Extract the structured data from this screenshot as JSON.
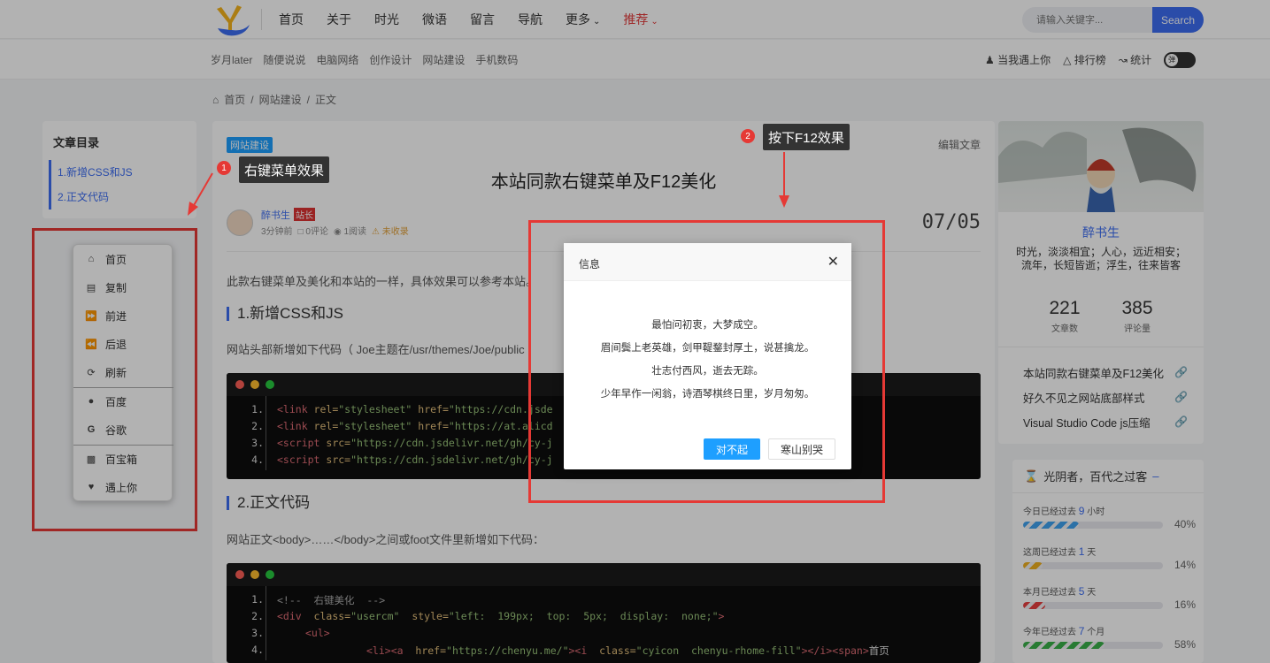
{
  "header": {
    "nav": [
      "首页",
      "关于",
      "时光",
      "微语",
      "留言",
      "导航"
    ],
    "more": "更多",
    "recommend": "推荐",
    "search_placeholder": "请输入关键字...",
    "search_button": "Search"
  },
  "subnav": {
    "links": [
      "岁月later",
      "随便说说",
      "电脑网络",
      "创作设计",
      "网站建设",
      "手机数码"
    ],
    "meet": "当我遇上你",
    "rank": "排行榜",
    "stats": "统计",
    "toggle_label": "弹"
  },
  "breadcrumb": {
    "home": "首页",
    "category": "网站建设",
    "current": "正文"
  },
  "toc": {
    "title": "文章目录",
    "items": [
      "1.新增CSS和JS",
      "2.正文代码"
    ]
  },
  "context_menu": {
    "items": [
      "首页",
      "复制",
      "前进",
      "后退",
      "刷新",
      "百度",
      "谷歌",
      "百宝箱",
      "遇上你"
    ]
  },
  "article": {
    "tag": "网站建设",
    "edit": "编辑文章",
    "title": "本站同款右键菜单及F12美化",
    "author": "醉书生",
    "author_badge": "站长",
    "time": "3分钟前",
    "comments": "0评论",
    "reads": "1阅读",
    "status": "未收录",
    "date": "07/05",
    "intro": "此款右键菜单及美化和本站的一样，具体效果可以参考本站。",
    "h1": "1.新增CSS和JS",
    "p1": "网站头部新增如下代码（ Joe主题在/usr/themes/Joe/public",
    "h2": "2.正文代码",
    "p2": "网站正文<body>……</body>之间或foot文件里新增如下代码："
  },
  "code1": {
    "lines": [
      {
        "n": "1.",
        "tag": "<link",
        "attr": " rel=",
        "str": "\"stylesheet\"",
        "attr2": " href=",
        "str2": "\"https://cdn.jsde"
      },
      {
        "n": "2.",
        "tag": "<link",
        "attr": " rel=",
        "str": "\"stylesheet\"",
        "attr2": " href=",
        "str2": "\"https://at.alicd"
      },
      {
        "n": "3.",
        "tag": "<script",
        "attr": " src=",
        "str": "\"https://cdn.jsdelivr.net/gh/cy-j",
        "attr2": "",
        "str2": ""
      },
      {
        "n": "4.",
        "tag": "<script",
        "attr": " src=",
        "str": "\"https://cdn.jsdelivr.net/gh/cy-j",
        "attr2": "",
        "str2": ""
      }
    ]
  },
  "code2": {
    "line1": "<!--  右键美化  -->",
    "line2_tag": "<div",
    "line2_attr": "  class=",
    "line2_str": "\"usercm\"",
    "line2_attr2": "  style=",
    "line2_str2": "\"left:  199px;  top:  5px;  display:  none;\"",
    "line2_end": ">",
    "line3": "<ul>",
    "line4_a": "<li><a",
    "line4_attr": "  href=",
    "line4_str": "\"https://chenyu.me/\"",
    "line4_b": "><i",
    "line4_attr2": "  class=",
    "line4_str2": "\"cyicon  chenyu-rhome-fill\"",
    "line4_c": "></i><span>",
    "line4_text": "首页",
    "nums": [
      "1.",
      "2.",
      "3.",
      "4."
    ]
  },
  "dialog": {
    "title": "信息",
    "lines": [
      "最怕问初衷，大梦成空。",
      "眉间鬓上老英雄，剑甲鞮鍪封厚土，说甚擒龙。",
      "壮志付西风，逝去无踪。",
      "少年早作一闲翁，诗酒琴棋终日里，岁月匆匆。"
    ],
    "ok": "对不起",
    "cancel": "寒山别哭"
  },
  "profile": {
    "name": "醉书生",
    "desc": "时光，淡淡相宜；人心，远近相安；流年，长短皆逝；浮生，往来皆客",
    "articles_num": "221",
    "articles_label": "文章数",
    "comments_num": "385",
    "comments_label": "评论量",
    "links": [
      "本站同款右键菜单及F12美化",
      "好久不见之网站底部样式",
      "Visual Studio Code js压缩"
    ]
  },
  "timecard": {
    "title": "光阴者，百代之过客",
    "rows": [
      {
        "pre": "今日已经过去",
        "val": "9",
        "unit": "小时",
        "pct": "40%",
        "fraction": 0.4,
        "color": "#3fa2f0"
      },
      {
        "pre": "这周已经过去",
        "val": "1",
        "unit": "天",
        "pct": "14%",
        "fraction": 0.14,
        "color": "#f0b020"
      },
      {
        "pre": "本月已经过去",
        "val": "5",
        "unit": "天",
        "pct": "16%",
        "fraction": 0.16,
        "color": "#e84040"
      },
      {
        "pre": "今年已经过去",
        "val": "7",
        "unit": "个月",
        "pct": "58%",
        "fraction": 0.58,
        "color": "#3ab14a"
      }
    ]
  },
  "annotations": {
    "note1": "右键菜单效果",
    "note2": "按下F12效果",
    "n1": "1",
    "n2": "2"
  }
}
